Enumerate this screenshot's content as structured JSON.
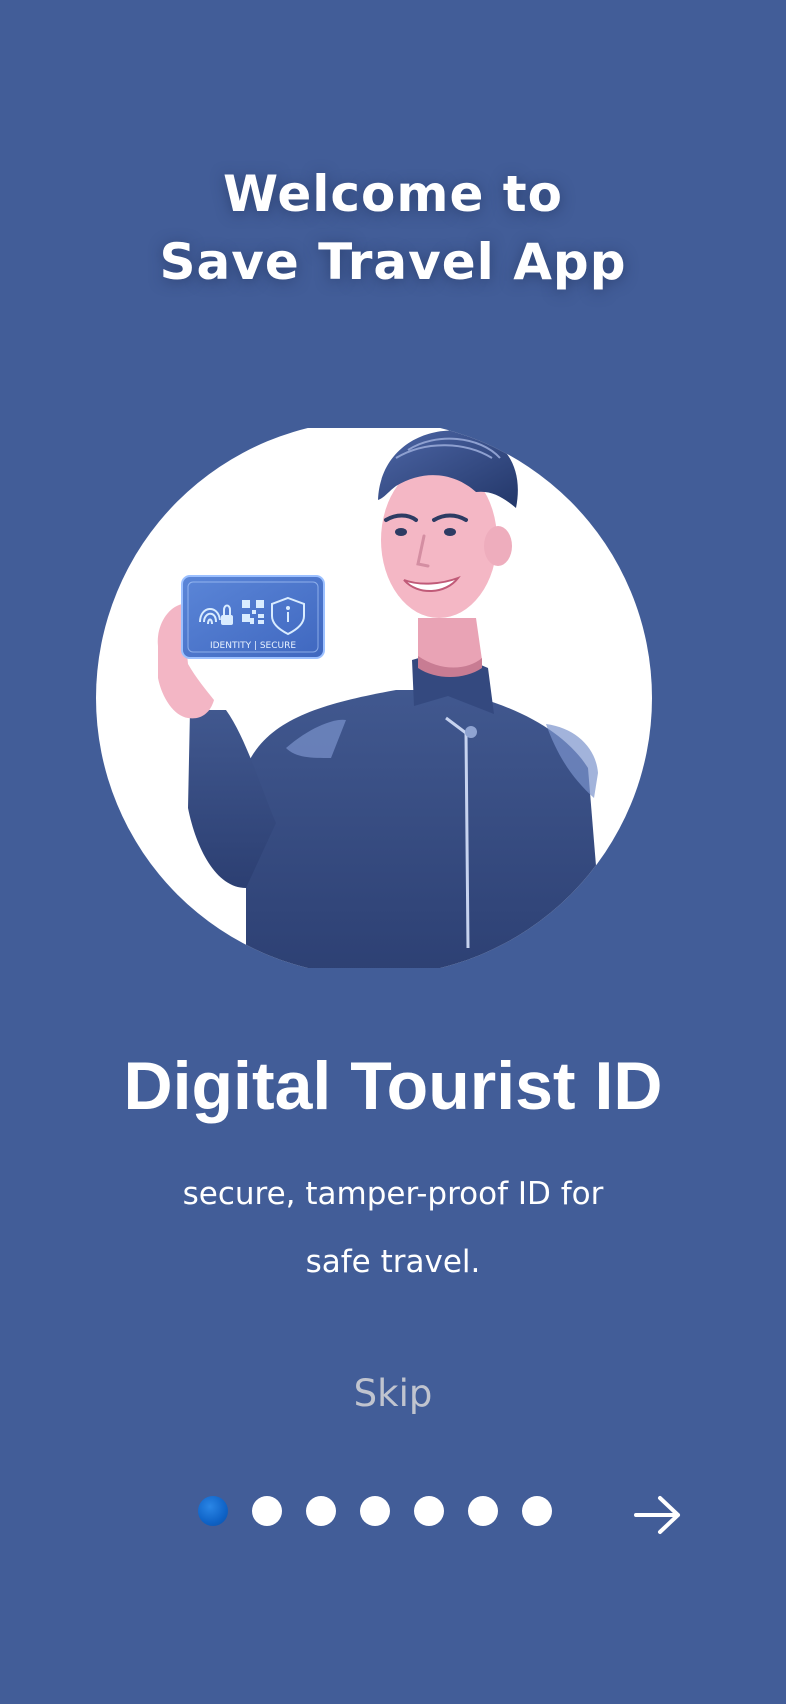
{
  "welcome": {
    "line1": "Welcome to",
    "line2": "Save Travel App"
  },
  "hero": {
    "image_name": "man-holding-digital-id-card-illustration",
    "card_text": "IDENTITY | SECURE"
  },
  "feature": {
    "title": "Digital Tourist ID",
    "desc_line1": "secure, tamper-proof ID for",
    "desc_line2": "safe travel."
  },
  "skip_label": "Skip",
  "pager": {
    "total": 7,
    "current": 1
  },
  "icons": {
    "next": "arrow-right-icon"
  },
  "colors": {
    "background": "#425d98",
    "active_dot": "#0f63c7",
    "inactive_dot": "#ffffff",
    "skip_text": "#c0c4cf"
  }
}
